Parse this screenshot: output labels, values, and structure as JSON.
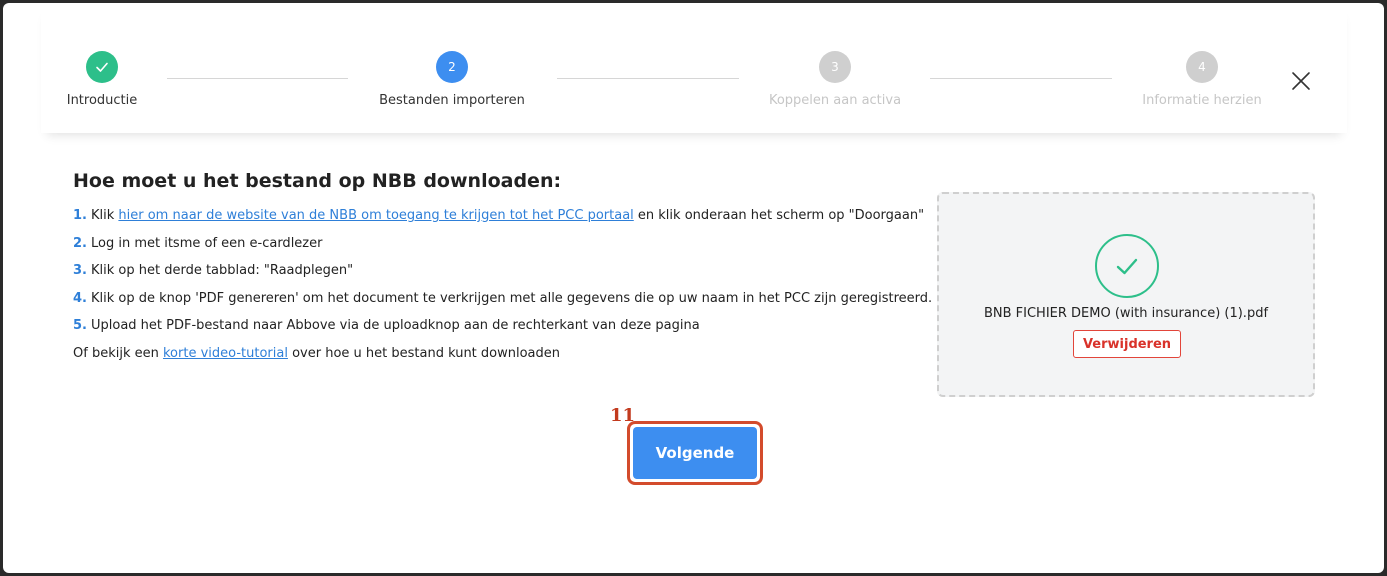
{
  "stepper": {
    "steps": [
      {
        "number": "",
        "label": "Introductie",
        "state": "done"
      },
      {
        "number": "2",
        "label": "Bestanden importeren",
        "state": "active"
      },
      {
        "number": "3",
        "label": "Koppelen aan activa",
        "state": "todo"
      },
      {
        "number": "4",
        "label": "Informatie herzien",
        "state": "todo"
      }
    ]
  },
  "content": {
    "heading": "Hoe moet u het bestand op NBB downloaden:",
    "steps": [
      {
        "num": "1.",
        "pre": "Klik ",
        "link": "hier om naar de website van de NBB om toegang te krijgen tot het PCC portaal",
        "post": " en klik onderaan het scherm op \"Doorgaan\""
      },
      {
        "num": "2.",
        "text": "Log in met itsme of een e-cardlezer"
      },
      {
        "num": "3.",
        "text": "Klik op het derde tabblad: \"Raadplegen\""
      },
      {
        "num": "4.",
        "text": "Klik op de knop 'PDF genereren' om het document te verkrijgen met alle gegevens die op uw naam in het PCC zijn geregistreerd."
      },
      {
        "num": "5.",
        "text": "Upload het PDF-bestand naar Abbove via de uploadknop aan de rechterkant van deze pagina"
      }
    ],
    "video": {
      "pre": "Of bekijk een ",
      "link": "korte video-tutorial",
      "post": " over hoe u het bestand kunt downloaden"
    }
  },
  "upload": {
    "file_name": "BNB FICHIER DEMO (with insurance) (1).pdf",
    "remove_label": "Verwijderen"
  },
  "footer": {
    "annotation_number": "11",
    "next_label": "Volgende"
  },
  "colors": {
    "accent": "#3d8ef0",
    "success": "#2dbf8a",
    "danger": "#e2453a",
    "annotation": "#d34b2c"
  }
}
